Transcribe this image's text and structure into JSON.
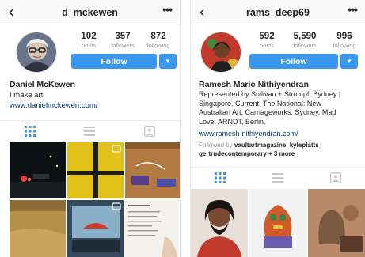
{
  "left": {
    "username": "d_mckewen",
    "stats": [
      {
        "value": "102",
        "label": "posts"
      },
      {
        "value": "357",
        "label": "followers"
      },
      {
        "value": "872",
        "label": "following"
      }
    ],
    "follow_label": "Follow",
    "full_name": "Daniel McKewen",
    "bio": "I make art.",
    "link": "www.danielmckewen.com/"
  },
  "right": {
    "username": "rams_deep69",
    "stats": [
      {
        "value": "592",
        "label": "posts"
      },
      {
        "value": "5,590",
        "label": "followers"
      },
      {
        "value": "996",
        "label": "following"
      }
    ],
    "follow_label": "Follow",
    "full_name": "Ramesh Mario Nithiyendran",
    "bio_line1": "Represented by Sullivan + Strumpf, Sydney |",
    "bio_line2": "Singapore. Current: The National: New",
    "bio_line3": "Australian Art, Carriageworks, Sydney. Mad",
    "bio_line4": "Love, ARNDT, Berlin.",
    "link": "www.ramesh-nithiyendran.com/",
    "followed_prefix": "Followed by",
    "followed_user1": "vaultartmagazine",
    "followed_user2": "kyleplatts",
    "followed_user3": "gertrudecontemporary",
    "followed_more": "+ 3 more"
  },
  "icons": {
    "back": "back-arrow-icon",
    "more": "more-options-icon",
    "grid": "grid-view-icon",
    "list": "list-view-icon",
    "tagged": "tagged-photos-icon",
    "dropdown": "dropdown-caret-icon"
  },
  "colors": {
    "follow_blue": "#3897f0",
    "link_blue": "#003569",
    "active_tab": "#3897f0",
    "inactive_tab": "#c7c7c7"
  }
}
